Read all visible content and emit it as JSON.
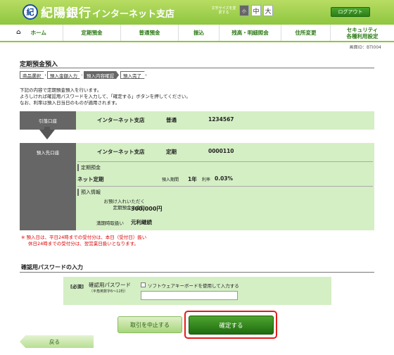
{
  "header": {
    "logo_char": "紀",
    "bank_name": "紀陽銀行",
    "branch_title": "インターネット支店",
    "font_size_label": "文字サイズを変更する",
    "font_sizes": [
      "小",
      "中",
      "大"
    ],
    "logout_label": "ログアウト"
  },
  "nav": {
    "home_icon": "⌂",
    "items": [
      "ホーム",
      "定期預金",
      "普通預金",
      "振込",
      "残高・明細照会",
      "住所変更",
      "セキュリティ\n各種利用設定"
    ]
  },
  "screen_id": "画面ID：BTI004",
  "page_title": "定期預金預入",
  "steps": [
    "商品選択",
    "預入金額入力",
    "預入内容確認",
    "預入完了"
  ],
  "current_step_index": 2,
  "intro_lines": [
    "下記の内容で定期預金預入を行います。",
    "よろしければ確認用パスワードを入力して、「確定する」ボタンを押してください。",
    "なお、利率は預入日当日のものが適用されます。"
  ],
  "debit_account": {
    "label": "引落口座",
    "branch": "インターネット支店",
    "type": "普通",
    "number": "1234567"
  },
  "deposit_account": {
    "label": "預入先口座",
    "branch": "インターネット支店",
    "type": "定期",
    "number": "0000110",
    "section1_title": "定期預金",
    "product": "ネット定期",
    "period_label": "預入期間",
    "period_value": "1年",
    "rate_label": "利率",
    "rate_value": "0.03%",
    "section2_title": "預入情報",
    "amount_label_1": "お預け入れいただく",
    "amount_label_2": "定期預金の金額",
    "amount_value": "300,000円",
    "maturity_label": "満期時取扱い",
    "maturity_value": "元利継続"
  },
  "notes": [
    "※ 預入日は、平日24時までの受付分は、本日（受付日）扱い",
    "休日24時までの受付分は、翌営業日扱いとなります。"
  ],
  "password_section": {
    "title": "確認用パスワードの入力",
    "required_label": "[必須]",
    "field_label": "確認用パスワード",
    "field_sublabel": "（半角英数字6～12桁）",
    "keyboard_option": "ソフトウェアキーボードを使用して入力する",
    "value": ""
  },
  "buttons": {
    "cancel": "取引を中止する",
    "confirm": "確定する",
    "back": "戻る"
  },
  "colors": {
    "header_green": "#8ec63f",
    "panel_green": "#d4efc4",
    "highlight_red": "#e41c1c"
  }
}
